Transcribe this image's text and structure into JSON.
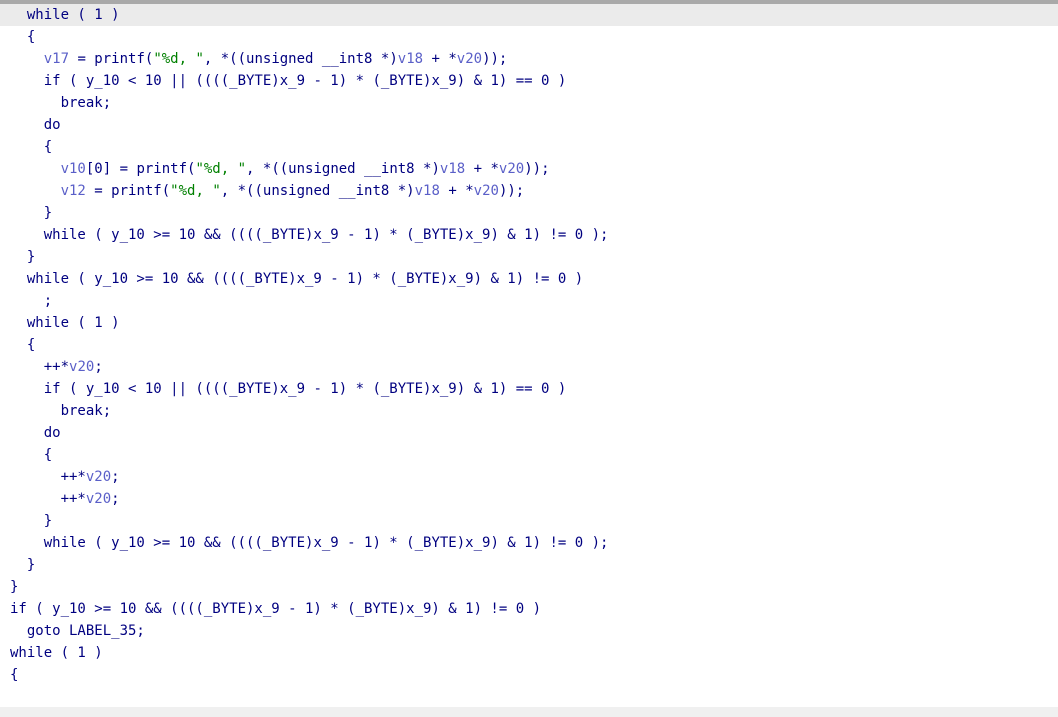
{
  "colors": {
    "code": "#000080",
    "var": "#5a5fc8",
    "string": "#008000",
    "current_line_bg": "#ebebeb",
    "background": "#ffffff"
  },
  "current_line": 0,
  "lines": [
    {
      "indent": 2,
      "segs": [
        {
          "t": "while ( 1 )",
          "c": "code"
        }
      ]
    },
    {
      "indent": 2,
      "segs": [
        {
          "t": "{",
          "c": "code"
        }
      ]
    },
    {
      "indent": 4,
      "segs": [
        {
          "t": "v17",
          "c": "var"
        },
        {
          "t": " = printf(",
          "c": "code"
        },
        {
          "t": "\"%d, \"",
          "c": "str"
        },
        {
          "t": ", *((unsigned __int8 *)",
          "c": "code"
        },
        {
          "t": "v18",
          "c": "var"
        },
        {
          "t": " + *",
          "c": "code"
        },
        {
          "t": "v20",
          "c": "var"
        },
        {
          "t": "));",
          "c": "code"
        }
      ]
    },
    {
      "indent": 4,
      "segs": [
        {
          "t": "if ( y_10 < 10 || ((((_BYTE)x_9 - 1) * (_BYTE)x_9) & 1) == 0 )",
          "c": "code"
        }
      ]
    },
    {
      "indent": 6,
      "segs": [
        {
          "t": "break;",
          "c": "code"
        }
      ]
    },
    {
      "indent": 4,
      "segs": [
        {
          "t": "do",
          "c": "code"
        }
      ]
    },
    {
      "indent": 4,
      "segs": [
        {
          "t": "{",
          "c": "code"
        }
      ]
    },
    {
      "indent": 6,
      "segs": [
        {
          "t": "v10",
          "c": "var"
        },
        {
          "t": "[0] = printf(",
          "c": "code"
        },
        {
          "t": "\"%d, \"",
          "c": "str"
        },
        {
          "t": ", *((unsigned __int8 *)",
          "c": "code"
        },
        {
          "t": "v18",
          "c": "var"
        },
        {
          "t": " + *",
          "c": "code"
        },
        {
          "t": "v20",
          "c": "var"
        },
        {
          "t": "));",
          "c": "code"
        }
      ]
    },
    {
      "indent": 6,
      "segs": [
        {
          "t": "v12",
          "c": "var"
        },
        {
          "t": " = printf(",
          "c": "code"
        },
        {
          "t": "\"%d, \"",
          "c": "str"
        },
        {
          "t": ", *((unsigned __int8 *)",
          "c": "code"
        },
        {
          "t": "v18",
          "c": "var"
        },
        {
          "t": " + *",
          "c": "code"
        },
        {
          "t": "v20",
          "c": "var"
        },
        {
          "t": "));",
          "c": "code"
        }
      ]
    },
    {
      "indent": 4,
      "segs": [
        {
          "t": "}",
          "c": "code"
        }
      ]
    },
    {
      "indent": 4,
      "segs": [
        {
          "t": "while ( y_10 >= 10 && ((((_BYTE)x_9 - 1) * (_BYTE)x_9) & 1) != 0 );",
          "c": "code"
        }
      ]
    },
    {
      "indent": 2,
      "segs": [
        {
          "t": "}",
          "c": "code"
        }
      ]
    },
    {
      "indent": 2,
      "segs": [
        {
          "t": "while ( y_10 >= 10 && ((((_BYTE)x_9 - 1) * (_BYTE)x_9) & 1) != 0 )",
          "c": "code"
        }
      ]
    },
    {
      "indent": 4,
      "segs": [
        {
          "t": ";",
          "c": "code"
        }
      ]
    },
    {
      "indent": 2,
      "segs": [
        {
          "t": "while ( 1 )",
          "c": "code"
        }
      ]
    },
    {
      "indent": 2,
      "segs": [
        {
          "t": "{",
          "c": "code"
        }
      ]
    },
    {
      "indent": 4,
      "segs": [
        {
          "t": "++*",
          "c": "code"
        },
        {
          "t": "v20",
          "c": "var"
        },
        {
          "t": ";",
          "c": "code"
        }
      ]
    },
    {
      "indent": 4,
      "segs": [
        {
          "t": "if ( y_10 < 10 || ((((_BYTE)x_9 - 1) * (_BYTE)x_9) & 1) == 0 )",
          "c": "code"
        }
      ]
    },
    {
      "indent": 6,
      "segs": [
        {
          "t": "break;",
          "c": "code"
        }
      ]
    },
    {
      "indent": 4,
      "segs": [
        {
          "t": "do",
          "c": "code"
        }
      ]
    },
    {
      "indent": 4,
      "segs": [
        {
          "t": "{",
          "c": "code"
        }
      ]
    },
    {
      "indent": 6,
      "segs": [
        {
          "t": "++*",
          "c": "code"
        },
        {
          "t": "v20",
          "c": "var"
        },
        {
          "t": ";",
          "c": "code"
        }
      ]
    },
    {
      "indent": 6,
      "segs": [
        {
          "t": "++*",
          "c": "code"
        },
        {
          "t": "v20",
          "c": "var"
        },
        {
          "t": ";",
          "c": "code"
        }
      ]
    },
    {
      "indent": 4,
      "segs": [
        {
          "t": "}",
          "c": "code"
        }
      ]
    },
    {
      "indent": 4,
      "segs": [
        {
          "t": "while ( y_10 >= 10 && ((((_BYTE)x_9 - 1) * (_BYTE)x_9) & 1) != 0 );",
          "c": "code"
        }
      ]
    },
    {
      "indent": 2,
      "segs": [
        {
          "t": "}",
          "c": "code"
        }
      ]
    },
    {
      "indent": 0,
      "segs": [
        {
          "t": "}",
          "c": "code"
        }
      ]
    },
    {
      "indent": 0,
      "segs": [
        {
          "t": "if ( y_10 >= 10 && ((((_BYTE)x_9 - 1) * (_BYTE)x_9) & 1) != 0 )",
          "c": "code"
        }
      ]
    },
    {
      "indent": 2,
      "segs": [
        {
          "t": "goto LABEL_35;",
          "c": "code"
        }
      ]
    },
    {
      "indent": 0,
      "segs": [
        {
          "t": "while ( 1 )",
          "c": "code"
        }
      ]
    },
    {
      "indent": 0,
      "segs": [
        {
          "t": "{",
          "c": "code"
        }
      ]
    }
  ]
}
